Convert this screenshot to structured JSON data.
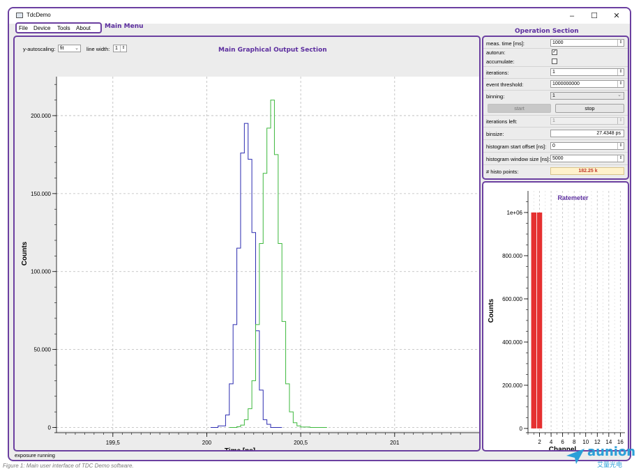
{
  "window": {
    "title": "TdcDemo",
    "minimize": "–",
    "maximize": "☐",
    "close": "✕"
  },
  "menu": {
    "items": [
      "File",
      "Device",
      "Tools",
      "About"
    ],
    "annotation": "Main Menu"
  },
  "plot_toolbar": {
    "autoscale_label": "y-autoscaling:",
    "autoscale_value": "fit",
    "linewidth_label": "line width:",
    "linewidth_value": "1"
  },
  "sections": {
    "main": "Main Graphical Output Section",
    "operation": "Operation Section",
    "ratemeter": "Ratemeter"
  },
  "operation": {
    "meas_time_label": "meas. time [ms]:",
    "meas_time_value": "1000",
    "autorun_label": "autorun:",
    "autorun_checked": true,
    "accumulate_label": "accumulate:",
    "accumulate_checked": false,
    "iterations_label": "iterations:",
    "iterations_value": "1",
    "event_threshold_label": "event threshold:",
    "event_threshold_value": "1000000000",
    "binning_label": "binning:",
    "binning_value": "1",
    "start_label": "start",
    "stop_label": "stop",
    "iterations_left_label": "iterations left:",
    "iterations_left_value": "1",
    "binsize_label": "binsize:",
    "binsize_value": "27.4348 ps",
    "hist_offset_label": "histogram start offset [ns]:",
    "hist_offset_value": "0",
    "hist_window_label": "histogram window size [ns]:",
    "hist_window_value": "5000",
    "histo_points_label": "# histo points:",
    "histo_points_value": "182.25 k",
    "histo_points_bg": "#fff2cc",
    "histo_points_color": "#c0392b"
  },
  "status": {
    "text": "exposure running"
  },
  "caption": {
    "text": "Figure 1: Main user interface of TDC Demo software."
  },
  "watermark": {
    "text": "aunion",
    "subtext": "艾量光电"
  },
  "chart_data": [
    {
      "type": "line",
      "xlabel": "Time [ns]",
      "ylabel": "Counts",
      "xlim": [
        199.2,
        201.45
      ],
      "ylim": [
        -2000,
        225000
      ],
      "xticks": [
        199.5,
        200,
        200.5,
        201
      ],
      "xtick_labels": [
        "199,5",
        "200",
        "200,5",
        "201"
      ],
      "yticks": [
        0,
        50000,
        100000,
        150000,
        200000
      ],
      "ytick_labels": [
        "0",
        "50.000",
        "100.000",
        "150.000",
        "200.000"
      ],
      "grid": true,
      "series": [
        {
          "color": "#2b2bb0",
          "x": [
            200.02,
            200.06,
            200.1,
            200.12,
            200.14,
            200.16,
            200.18,
            200.2,
            200.22,
            200.24,
            200.26,
            200.28,
            200.3,
            200.32,
            200.34,
            200.36,
            200.4
          ],
          "y": [
            0,
            1000,
            8000,
            28000,
            66000,
            115000,
            176000,
            195000,
            172000,
            125000,
            62000,
            24000,
            5000,
            2000,
            0,
            0,
            0
          ]
        },
        {
          "color": "#3cb83c",
          "x": [
            200.12,
            200.14,
            200.16,
            200.18,
            200.2,
            200.22,
            200.24,
            200.26,
            200.28,
            200.3,
            200.32,
            200.34,
            200.36,
            200.38,
            200.4,
            200.42,
            200.44,
            200.46,
            200.48,
            200.5,
            200.55,
            200.64
          ],
          "y": [
            0,
            0,
            500,
            1500,
            5000,
            12000,
            30000,
            66000,
            118000,
            163000,
            192000,
            210000,
            175000,
            118000,
            68000,
            28000,
            10000,
            3000,
            1000,
            300,
            0,
            0
          ]
        }
      ]
    },
    {
      "type": "bar",
      "title": "Ratemeter",
      "xlabel": "Channel",
      "ylabel": "Counts",
      "xlim": [
        0,
        16.8
      ],
      "ylim": [
        -10000,
        1100000
      ],
      "xticks": [
        2,
        4,
        6,
        8,
        10,
        12,
        14,
        16
      ],
      "yticks": [
        0,
        200000,
        400000,
        600000,
        800000,
        1000000
      ],
      "ytick_labels": [
        "0",
        "200.000",
        "400.000",
        "600.000",
        "800.000",
        "1e+06"
      ],
      "grid": true,
      "color": "#e53030",
      "categories": [
        1,
        2
      ],
      "values": [
        1000000,
        1000000
      ]
    }
  ]
}
